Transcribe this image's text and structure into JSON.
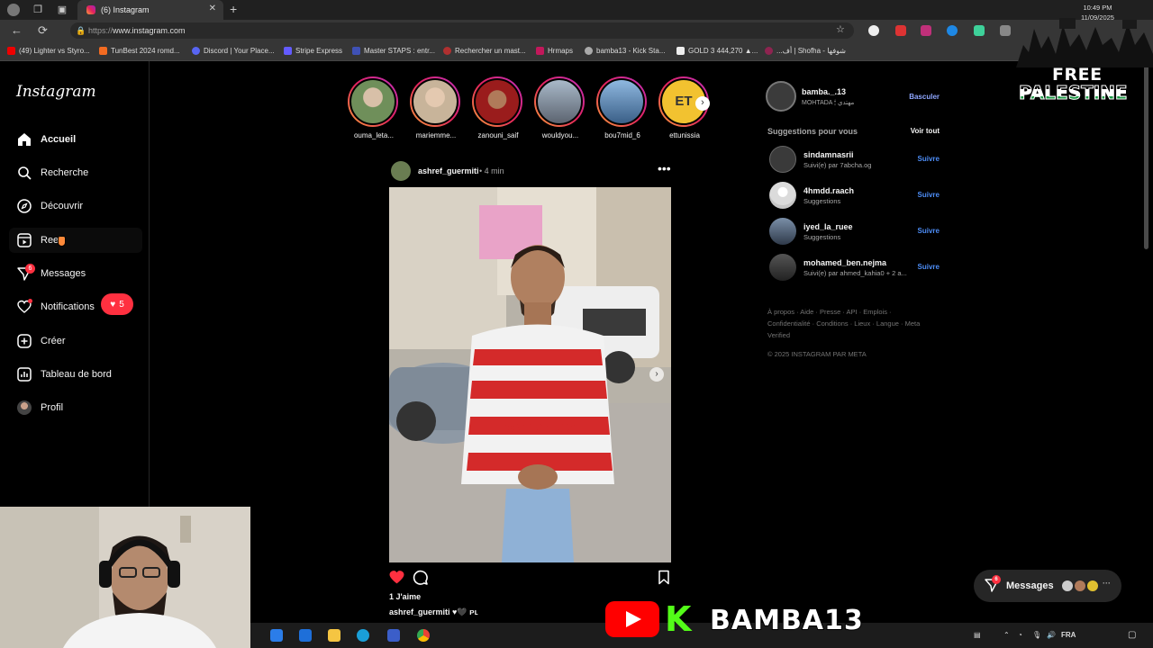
{
  "browser": {
    "tab_title": "(6) Instagram",
    "url_prefix": "https://",
    "url_domain": "www.instagram.com",
    "bookmarks": [
      "(49) Lighter vs Styro...",
      "TunBest 2024 romd...",
      "Discord | Your Place...",
      "Stripe Express",
      "Master STAPS : entr...",
      "Rechercher un mast...",
      "Hrmaps",
      "bamba13 - Kick Sta...",
      "GOLD 3 444,270 ▲...",
      "...أف | Shofha - شوفها"
    ]
  },
  "instagram": {
    "logo": "Instagram",
    "nav": [
      {
        "label": "Accueil",
        "icon": "home-icon"
      },
      {
        "label": "Recherche",
        "icon": "search-icon"
      },
      {
        "label": "Découvrir",
        "icon": "compass-icon"
      },
      {
        "label": "Reels",
        "icon": "reels-icon"
      },
      {
        "label": "Messages",
        "icon": "messenger-icon"
      },
      {
        "label": "Notifications",
        "icon": "heart-icon"
      },
      {
        "label": "Créer",
        "icon": "plus-square-icon"
      },
      {
        "label": "Tableau de bord",
        "icon": "dashboard-icon"
      },
      {
        "label": "Profil",
        "icon": "avatar"
      }
    ],
    "messages_badge": "6",
    "notification_count": "5",
    "stories": [
      "ouma_leta...",
      "mariemme...",
      "zanouni_saif",
      "wouldyou...",
      "bou7mid_6",
      "ettunissia"
    ],
    "post": {
      "username": "ashref_guermiti",
      "time": "• 4 min",
      "likes": "1 J'aime",
      "caption": "ashref_guermiti ♥🖤 ᴘʟ"
    },
    "account": {
      "username": "bamba._.13",
      "full_name": "MOHTADA 🕯 مهتدي",
      "switch_label": "Basculer"
    },
    "suggestions_title": "Suggestions pour vous",
    "see_all": "Voir tout",
    "suggestions": [
      {
        "username": "sindamnasrii",
        "sub": "Suivi(e) par 7abcha.og",
        "action": "Suivre"
      },
      {
        "username": "4hmdd.raach",
        "sub": "Suggestions",
        "action": "Suivre"
      },
      {
        "username": "iyed_la_ruee",
        "sub": "Suggestions",
        "action": "Suivre"
      },
      {
        "username": "mohamed_ben.nejma",
        "sub": "Suivi(e) par ahmed_kahia0 + 2 a...",
        "action": "Suivre"
      }
    ],
    "footer_links": "À propos · Aide · Presse · API · Emplois · Confidentialité · Conditions · Lieux · Langue · Meta Verified",
    "copyright": "© 2025 INSTAGRAM PAR META",
    "messages_float": "Messages",
    "messages_float_badge": "6"
  },
  "overlay": {
    "free_1": "FREE",
    "free_2": "PALESTINE",
    "streamer": "BAMBA13"
  },
  "taskbar": {
    "lang": "FRA",
    "time": "10:49 PM",
    "date": "11/09/2025"
  },
  "colors": {
    "like_red": "#ff3040",
    "link_blue": "#4d8df6",
    "kick_green": "#53fc18"
  }
}
